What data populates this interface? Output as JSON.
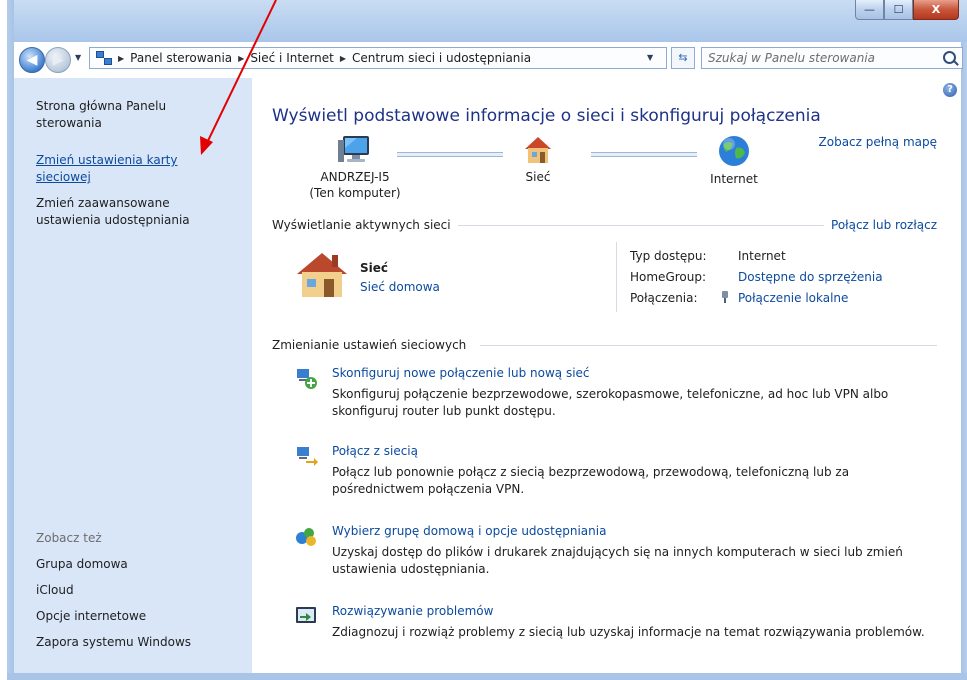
{
  "window": {
    "buttons": {
      "minimize": "—",
      "maximize": "☐",
      "close": "X"
    }
  },
  "address": {
    "breadcrumbs": [
      "Panel sterowania",
      "Sieć i Internet",
      "Centrum sieci i udostępniania"
    ],
    "search_placeholder": "Szukaj w Panelu sterowania"
  },
  "sidebar": {
    "links": [
      "Strona główna Panelu sterowania",
      "Zmień ustawienia karty sieciowej",
      "Zmień zaawansowane ustawienia udostępniania"
    ],
    "see_also_heading": "Zobacz też",
    "see_also": [
      "Grupa domowa",
      "iCloud",
      "Opcje internetowe",
      "Zapora systemu Windows"
    ]
  },
  "main": {
    "title": "Wyświetl podstawowe informacje o sieci i skonfiguruj połączenia",
    "full_map_link": "Zobacz pełną mapę",
    "map": {
      "computer_name": "ANDRZEJ-I5",
      "computer_sub": "(Ten komputer)",
      "network": "Sieć",
      "internet": "Internet"
    },
    "active_networks": {
      "heading": "Wyświetlanie aktywnych sieci",
      "connect_link": "Połącz lub rozłącz",
      "network_name": "Sieć",
      "network_type": "Sieć domowa",
      "access_type_label": "Typ dostępu:",
      "access_type_value": "Internet",
      "homegroup_label": "HomeGroup:",
      "homegroup_value": "Dostępne do sprzężenia",
      "connections_label": "Połączenia:",
      "connections_value": "Połączenie lokalne"
    },
    "settings": {
      "heading": "Zmienianie ustawień sieciowych",
      "tasks": [
        {
          "title": "Skonfiguruj nowe połączenie lub nową sieć",
          "desc": "Skonfiguruj połączenie bezprzewodowe, szerokopasmowe, telefoniczne, ad hoc lub VPN albo skonfiguruj router lub punkt dostępu.",
          "icon": "new-connection-icon"
        },
        {
          "title": "Połącz z siecią",
          "desc": "Połącz lub ponownie połącz z siecią bezprzewodową, przewodową, telefoniczną lub za pośrednictwem połączenia VPN.",
          "icon": "connect-network-icon"
        },
        {
          "title": "Wybierz grupę domową i opcje udostępniania",
          "desc": "Uzyskaj dostęp do plików i drukarek znajdujących się na innych komputerach w sieci lub zmień ustawienia udostępniania.",
          "icon": "homegroup-icon"
        },
        {
          "title": "Rozwiązywanie problemów",
          "desc": "Zdiagnozuj i rozwiąż problemy z siecią lub uzyskaj informacje na temat rozwiązywania problemów.",
          "icon": "troubleshoot-icon"
        }
      ]
    }
  },
  "colors": {
    "link": "#0b4a9e",
    "title": "#1e3287",
    "sidebar_bg": "#d9e6f8",
    "annotation_arrow": "#e30000"
  }
}
